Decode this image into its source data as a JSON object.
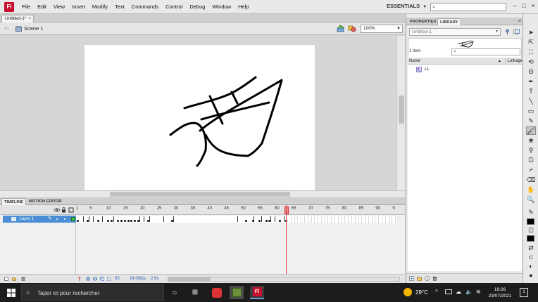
{
  "app": {
    "logo_text": "Fl",
    "menu": [
      "File",
      "Edit",
      "View",
      "Insert",
      "Modify",
      "Text",
      "Commands",
      "Control",
      "Debug",
      "Window",
      "Help"
    ],
    "workspace": "ESSENTIALS",
    "search_placeholder": "⌕"
  },
  "document": {
    "tab_title": "Untitled-1*",
    "close": "×",
    "scene": "Scene 1",
    "zoom": "100%"
  },
  "timeline": {
    "tabs": [
      "TIMELINE",
      "MOTION EDITOR"
    ],
    "ruler": [
      "1",
      "5",
      "10",
      "15",
      "20",
      "25",
      "30",
      "35",
      "40",
      "45",
      "50",
      "55",
      "60",
      "65",
      "70",
      "75",
      "80",
      "85",
      "90",
      "9"
    ],
    "layer_name": "Layer 1",
    "current_frame": "63",
    "fps": "24.00fps",
    "time": "2.6s"
  },
  "panels": {
    "tabs": [
      "PROPERTIES",
      "LIBRARY"
    ],
    "library_doc": "Untitled-1",
    "item_count": "1 item",
    "search_placeholder": "⌕",
    "col_name": "Name",
    "col_linkage": "Linkage",
    "items": [
      {
        "name": "LL"
      }
    ]
  },
  "taskbar": {
    "search_text": "Taper ici pour rechercher",
    "temperature": "29°C",
    "time": "19:26",
    "date": "23/07/2021",
    "notifications": "1"
  },
  "colors": {
    "accent_blue": "#4a8fd6",
    "playhead": "#e23b3b",
    "brand_red": "#c8102e"
  }
}
